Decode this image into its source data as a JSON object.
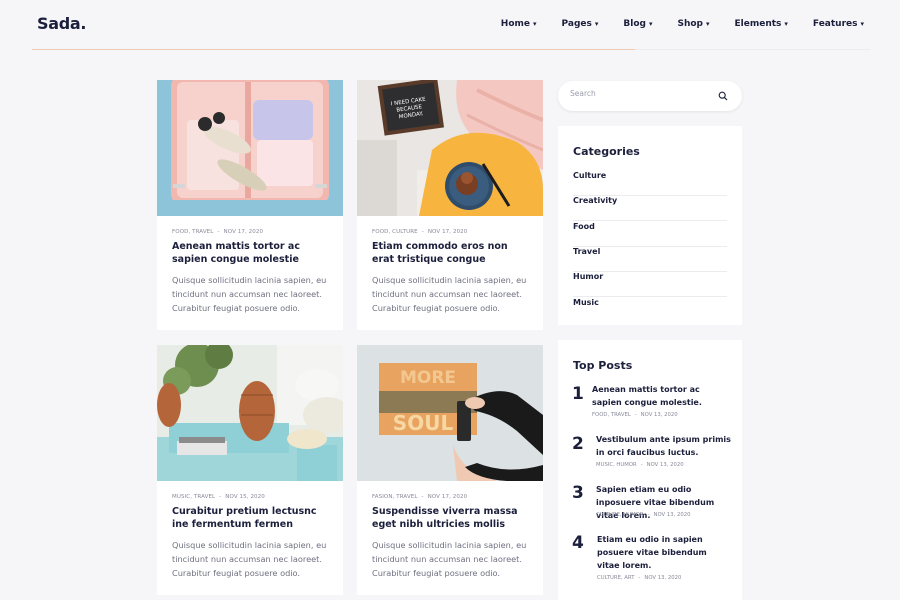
{
  "header": {
    "logo": "Sada.",
    "nav": [
      {
        "label": "Home"
      },
      {
        "label": "Pages"
      },
      {
        "label": "Blog"
      },
      {
        "label": "Shop"
      },
      {
        "label": "Elements"
      },
      {
        "label": "Features"
      }
    ]
  },
  "posts": [
    {
      "categories": "FOOD, TRAVEL",
      "date": "NOV 17, 2020",
      "title": "Aenean mattis tortor ac sapien congue molestie",
      "excerpt": "Quisque sollicitudin lacinia sapien, eu tincidunt nun accumsan nec laoreet. Curabitur feugiat posuere odio."
    },
    {
      "categories": "FOOD, CULTURE",
      "date": "NOV 17, 2020",
      "title": "Etiam commodo eros non erat tristique congue",
      "excerpt": "Quisque sollicitudin lacinia sapien, eu tincidunt nun accumsan nec laoreet. Curabitur feugiat posuere odio."
    },
    {
      "categories": "MUSIC, TRAVEL",
      "date": "NOV 15, 2020",
      "title": "Curabitur pretium lectusnc ine fermentum fermen",
      "excerpt": "Quisque sollicitudin lacinia sapien, eu tincidunt nun accumsan nec laoreet. Curabitur feugiat posuere odio."
    },
    {
      "categories": "FASION, TRAVEL",
      "date": "NOV 17, 2020",
      "title": "Suspendisse viverra massa eget nibh ultricies mollis",
      "excerpt": "Quisque sollicitudin lacinia sapien, eu tincidunt nun accumsan nec laoreet. Curabitur feugiat posuere odio."
    }
  ],
  "images": {
    "letterboard_text": "I NEED CAKE BECAUSE MONDAY.",
    "poster_text_top": "MORE",
    "poster_text_bottom": "SOUL"
  },
  "sidebar": {
    "search": {
      "placeholder": "Search"
    },
    "categories": {
      "title": "Categories",
      "items": [
        "Culture",
        "Creativity",
        "Food",
        "Travel",
        "Humor",
        "Music"
      ]
    },
    "top_posts": {
      "title": "Top Posts",
      "items": [
        {
          "num": "1",
          "title": "Aenean mattis tortor ac sapien congue molestie.",
          "categories": "FOOD, TRAVEL",
          "date": "NOV 13, 2020"
        },
        {
          "num": "2",
          "title": "Vestibulum ante ipsum primis in orci faucibus luctus.",
          "categories": "MUSIC, HUMOR",
          "date": "NOV 13, 2020"
        },
        {
          "num": "3",
          "title": "Sapien etiam eu odio inposuere vitae bibendum vitae lorem.",
          "categories": "CULTURE, HUMOR",
          "date": "NOV 13, 2020"
        },
        {
          "num": "4",
          "title": "Etiam eu odio in sapien posuere vitae bibendum vitae lorem.",
          "categories": "CULTURE, ART",
          "date": "NOV 13, 2020"
        }
      ]
    }
  },
  "colors": {
    "brand": "#1b1f3b",
    "accent_line": "#efc9b4",
    "background": "#f6f6f8"
  }
}
